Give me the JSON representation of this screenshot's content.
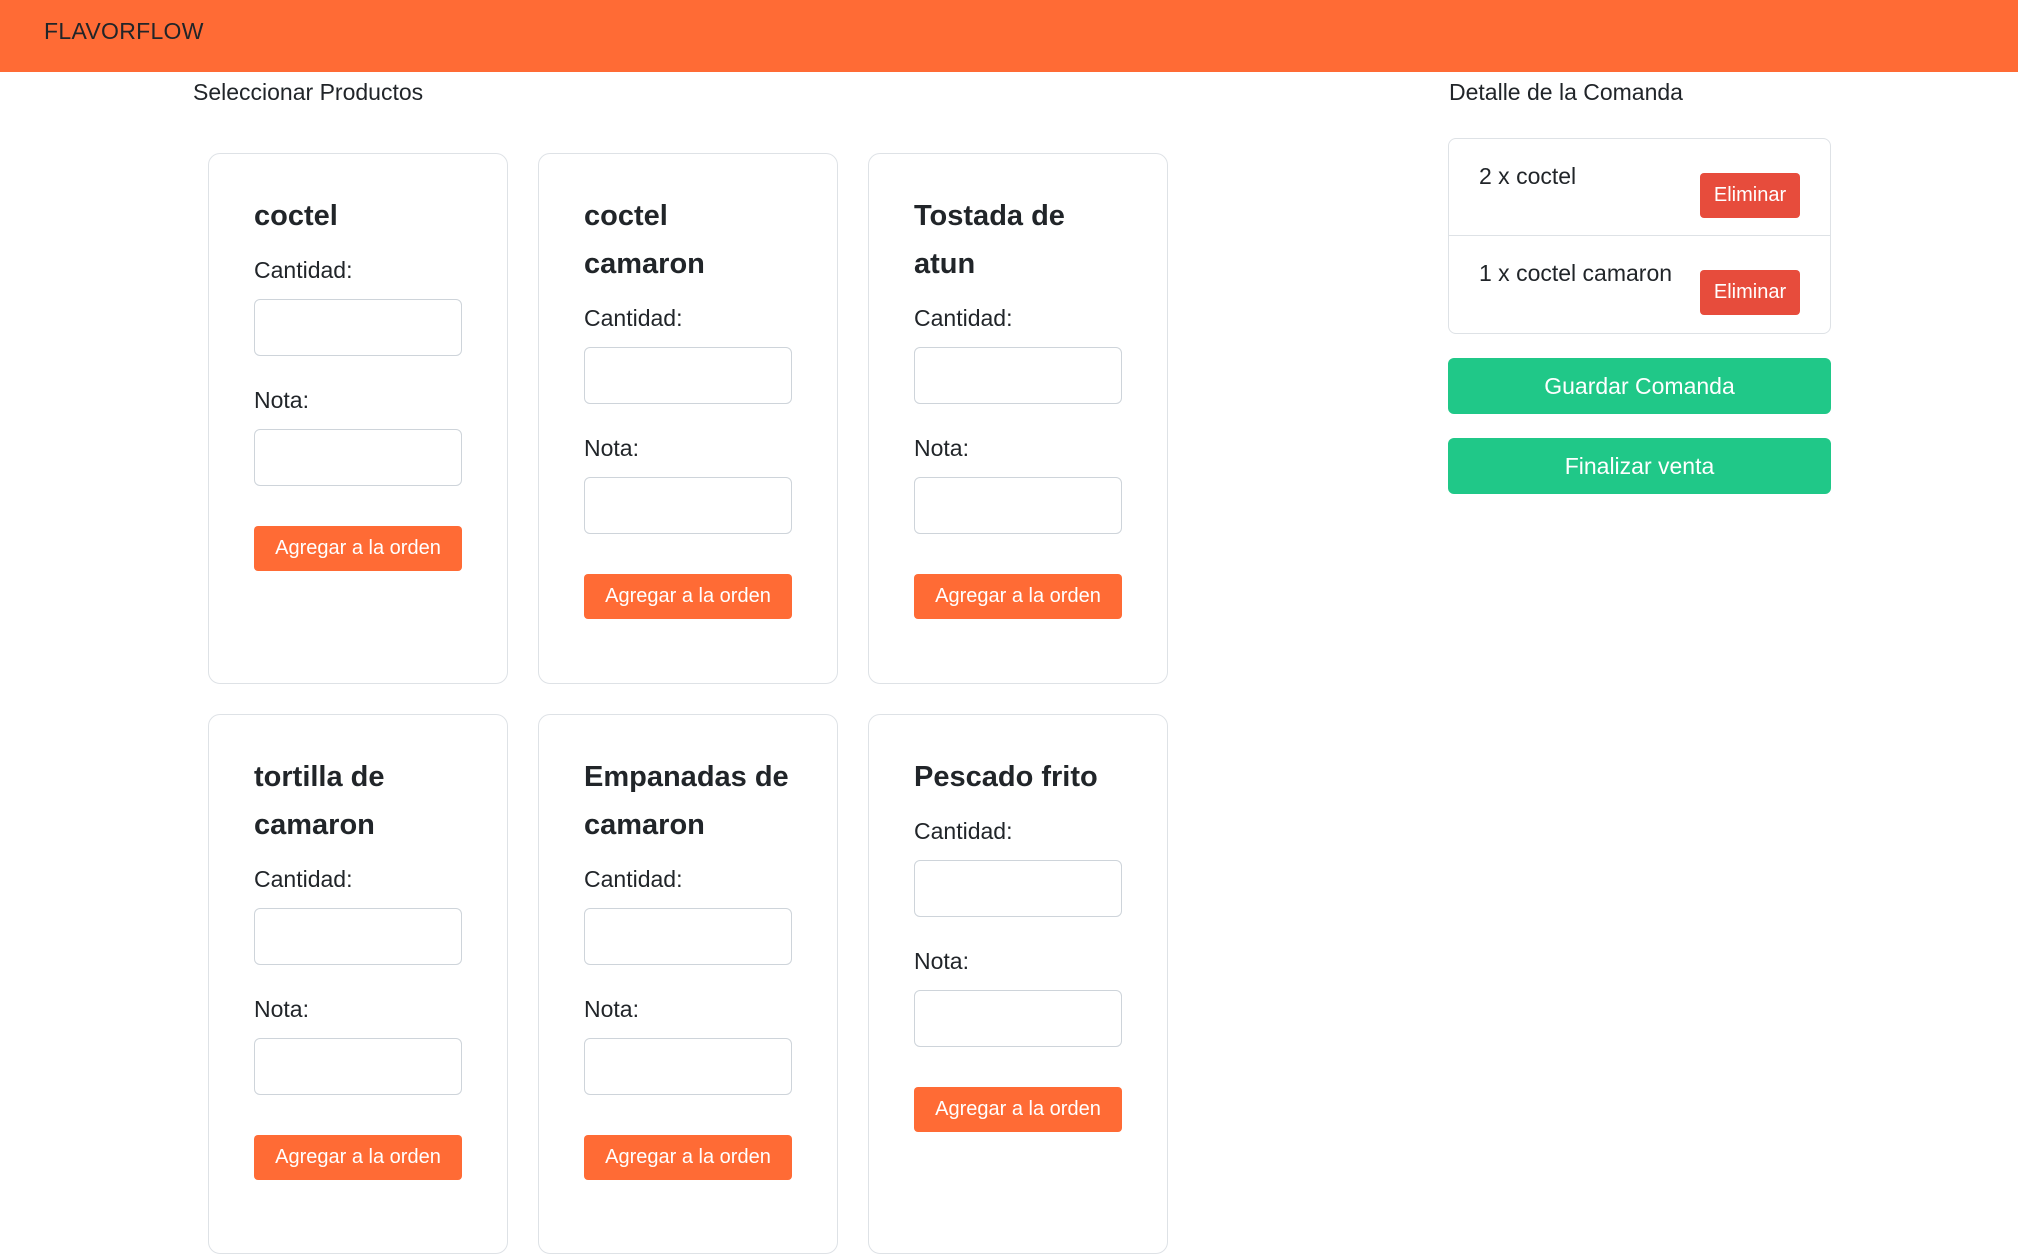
{
  "navbar": {
    "brand": "FLAVORFLOW"
  },
  "products_section": {
    "title": "Seleccionar Productos",
    "quantity_label": "Cantidad:",
    "note_label": "Nota:",
    "add_button_label": "Agregar a la orden",
    "products": [
      {
        "name": "coctel"
      },
      {
        "name": "coctel camaron"
      },
      {
        "name": "Tostada de atun"
      },
      {
        "name": "tortilla de camaron"
      },
      {
        "name": "Empanadas de camaron"
      },
      {
        "name": "Pescado frito"
      }
    ]
  },
  "order_section": {
    "title": "Detalle de la Comanda",
    "items": [
      {
        "text": "2 x coctel",
        "delete_label": "Eliminar"
      },
      {
        "text": "1 x coctel camaron",
        "delete_label": "Eliminar"
      }
    ],
    "save_button_label": "Guardar Comanda",
    "finish_button_label": "Finalizar venta"
  },
  "colors": {
    "brand": "#ff6b35",
    "danger": "#e74c3c",
    "success": "#20c888"
  }
}
